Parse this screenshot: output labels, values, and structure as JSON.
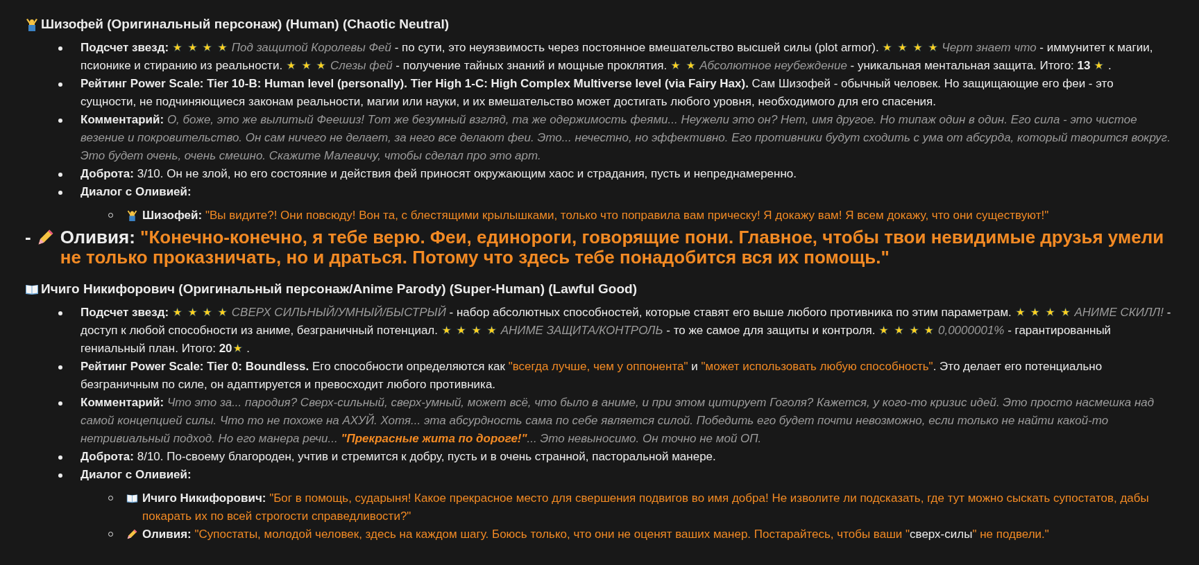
{
  "sections": [
    {
      "heading": {
        "title": "Шизофей (Оригинальный персонаж) (Human) (Chaotic Neutral)"
      },
      "items": [
        {
          "kind": "text",
          "segments": [
            {
              "kind": "bold",
              "text": "Подсчет звезд: "
            },
            {
              "kind": "stars",
              "text": "★ ★ ★ ★"
            },
            {
              "kind": "italic",
              "text": " Под защитой Королевы Фей"
            },
            {
              "kind": "text",
              "text": " - по сути, это неуязвимость через постоянное вмешательство высшей силы (plot armor). "
            },
            {
              "kind": "stars",
              "text": "★ ★ ★ ★"
            },
            {
              "kind": "italic",
              "text": " Черт знает что"
            },
            {
              "kind": "text",
              "text": " - иммунитет к магии, псионике и стиранию из реальности. "
            },
            {
              "kind": "stars",
              "text": "★ ★ ★"
            },
            {
              "kind": "italic",
              "text": " Слезы фей"
            },
            {
              "kind": "text",
              "text": " - получение тайных знаний и мощные проклятия. "
            },
            {
              "kind": "stars",
              "text": "★ ★"
            },
            {
              "kind": "italic",
              "text": " Абсолютное неубеждение"
            },
            {
              "kind": "text",
              "text": " - уникальная ментальная защита. Итого: "
            },
            {
              "kind": "bold",
              "text": "13 "
            },
            {
              "kind": "stars",
              "text": "★"
            },
            {
              "kind": "text",
              "text": " ."
            }
          ]
        },
        {
          "kind": "text",
          "segments": [
            {
              "kind": "bold",
              "text": "Рейтинг Power Scale: Tier 10-B: Human level (personally). Tier High 1-C: High Complex Multiverse level (via Fairy Hax)."
            },
            {
              "kind": "text",
              "text": " Сам Шизофей - обычный человек. Но защищающие его феи - это сущности, не подчиняющиеся законам реальности, магии или науки, и их вмешательство может достигать любого уровня, необходимого для его спасения."
            }
          ]
        },
        {
          "kind": "text",
          "segments": [
            {
              "kind": "bold",
              "text": "Комментарий: "
            },
            {
              "kind": "italic",
              "text": "О, боже, это же вылитый Феешиз! Тот же безумный взгляд, та же одержимость феями... Неужели это он? Нет, имя другое. Но типаж один в один. Его сила - это чистое везение и покровительство. Он сам ничего не делает, за него все делают феи. Это... нечестно, но эффективно. Его противники будут сходить с ума от абсурда, который творится вокруг. Это будет очень, очень смешно. Скажите Малевичу, чтобы сделал про это арт."
            }
          ]
        },
        {
          "kind": "text",
          "segments": [
            {
              "kind": "bold",
              "text": "Доброта: "
            },
            {
              "kind": "text",
              "text": "3/10. Он не злой, но его состояние и действия фей приносят окружающим хаос и страдания, пусть и непреднамеренно."
            }
          ]
        },
        {
          "kind": "dialog",
          "segments": [
            {
              "kind": "bold",
              "text": "Диалог с Оливией:"
            }
          ],
          "lines": [
            {
              "kind": "guest",
              "speaker": "Шизофей:",
              "segments": [
                {
                  "kind": "quote",
                  "text": "\"Вы видите?! Они повсюду! Вон та, с блестящими крылышками, только что поправила вам прическу! Я докажу вам! Я всем докажу, что они существуют!\""
                }
              ]
            }
          ]
        }
      ]
    },
    {
      "banner": {
        "dash": "-",
        "speaker": "Оливия:",
        "segments": [
          {
            "kind": "quote",
            "text": "\"Конечно-конечно, я тебе верю. Феи, единороги, говорящие пони. Главное, чтобы твои невидимые друзья умели не только проказничать, но и драться. Потому что здесь тебе понадобится вся их помощь.\""
          }
        ]
      }
    },
    {
      "heading": {
        "title": "Ичиго Никифорович (Оригинальный персонаж/Anime Parody) (Super-Human) (Lawful Good)"
      },
      "items": [
        {
          "kind": "text",
          "segments": [
            {
              "kind": "bold",
              "text": "Подсчет звезд: "
            },
            {
              "kind": "stars",
              "text": "★ ★ ★ ★"
            },
            {
              "kind": "italic",
              "text": " СВЕРХ СИЛЬНЫЙ/УМНЫЙ/БЫСТРЫЙ"
            },
            {
              "kind": "text",
              "text": " - набор абсолютных способностей, которые ставят его выше любого противника по этим параметрам. "
            },
            {
              "kind": "stars",
              "text": "★ ★ ★ ★"
            },
            {
              "kind": "italic",
              "text": " АНИМЕ СКИЛЛ!"
            },
            {
              "kind": "text",
              "text": " - доступ к любой способности из аниме, безграничный потенциал. "
            },
            {
              "kind": "stars",
              "text": "★ ★ ★ ★"
            },
            {
              "kind": "italic",
              "text": " АНИМЕ ЗАЩИТА/КОНТРОЛЬ"
            },
            {
              "kind": "text",
              "text": " - то же самое для защиты и контроля. "
            },
            {
              "kind": "stars",
              "text": "★ ★ ★ ★"
            },
            {
              "kind": "italic",
              "text": " 0,0000001%"
            },
            {
              "kind": "text",
              "text": " - гарантированный гениальный план. Итого: "
            },
            {
              "kind": "bold",
              "text": "20"
            },
            {
              "kind": "stars",
              "text": "★"
            },
            {
              "kind": "text",
              "text": " ."
            }
          ]
        },
        {
          "kind": "text",
          "segments": [
            {
              "kind": "bold",
              "text": "Рейтинг Power Scale: Tier 0: Boundless."
            },
            {
              "kind": "text",
              "text": " Его способности определяются как "
            },
            {
              "kind": "quote",
              "text": "\"всегда лучше, чем у оппонента\""
            },
            {
              "kind": "text",
              "text": " и "
            },
            {
              "kind": "quote",
              "text": "\"может использовать любую способность\""
            },
            {
              "kind": "text",
              "text": ". Это делает его потенциально безграничным по силе, он адаптируется и превосходит любого противника."
            }
          ]
        },
        {
          "kind": "text",
          "segments": [
            {
              "kind": "bold",
              "text": "Комментарий: "
            },
            {
              "kind": "italic",
              "text": "Что это за... пародия? Сверх-сильный, сверх-умный, может всё, что было в аниме, и при этом цитирует Гоголя? Кажется, у кого-то кризис идей. Это просто насмешка над самой концепцией силы. Что то не похоже на АХУЙ. Хотя... эта абсурдность сама по себе является силой. Победить его будет почти невозможно, если только не найти какой-то нетривиальный подход. Но его манера речи... "
            },
            {
              "kind": "quote_em",
              "text": "\"Прекрасные жита по дороге!\""
            },
            {
              "kind": "italic",
              "text": "... Это невыносимо. Он точно не мой ОП."
            }
          ]
        },
        {
          "kind": "text",
          "segments": [
            {
              "kind": "bold",
              "text": "Доброта: "
            },
            {
              "kind": "text",
              "text": "8/10. По-своему благороден, учтив и стремится к добру, пусть и в очень странной, пасторальной манере."
            }
          ]
        },
        {
          "kind": "dialog",
          "segments": [
            {
              "kind": "bold",
              "text": "Диалог с Оливией:"
            }
          ],
          "lines": [
            {
              "kind": "guest",
              "speaker": "Ичиго Никифорович:",
              "segments": [
                {
                  "kind": "quote",
                  "text": "\"Бог в помощь, сударыня! Какое прекрасное место для свершения подвигов во имя добра! Не изволите ли подсказать, где тут можно сыскать супостатов, дабы покарать их по всей строгости справедливости?\""
                }
              ]
            },
            {
              "kind": "host",
              "speaker": "Оливия:",
              "segments": [
                {
                  "kind": "quote",
                  "text": "\"Супостаты, молодой человек, здесь на каждом шагу. Боюсь только, что они не оценят ваших манер. Постарайтесь, чтобы ваши \""
                },
                {
                  "kind": "text",
                  "text": "сверх-силы"
                },
                {
                  "kind": "quote",
                  "text": "\" не подвели.\""
                }
              ]
            }
          ]
        }
      ]
    }
  ]
}
